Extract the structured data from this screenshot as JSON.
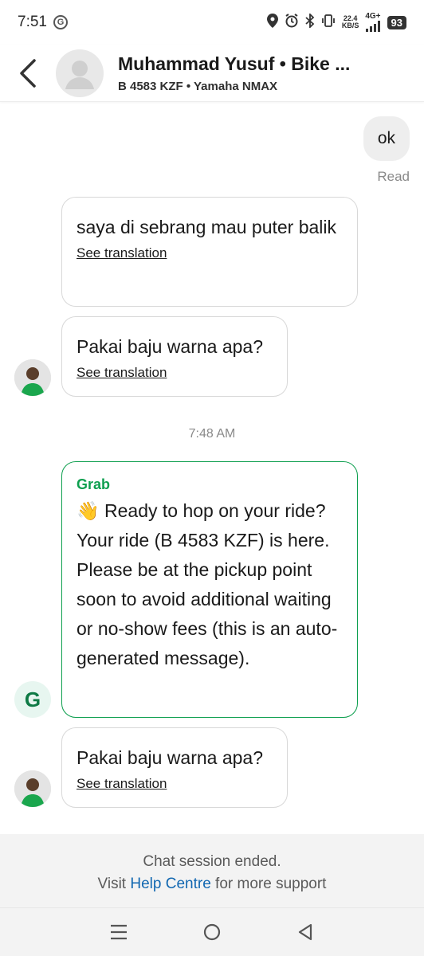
{
  "status_bar": {
    "time": "7:51",
    "carrier_icon_letter": "G",
    "net_speed_value": "22.4",
    "net_speed_unit": "KB/S",
    "network_type": "4G+",
    "battery": "93"
  },
  "header": {
    "driver_name": "Muhammad Yusuf • Bike ...",
    "vehicle_info": "B 4583 KZF • Yamaha NMAX"
  },
  "messages": {
    "outgoing_1": {
      "text": "ok",
      "status": "Read"
    },
    "incoming_1": {
      "text": "saya di sebrang mau puter balik",
      "translate_label": "See translation"
    },
    "incoming_2": {
      "text": "Pakai baju warna apa?",
      "translate_label": "See translation"
    },
    "timestamp": "7:48 AM",
    "system_1": {
      "sender": "Grab",
      "text": "👋 Ready to hop on your ride? Your ride (B 4583 KZF) is here. Please be at the pickup point soon to avoid additional waiting or no-show fees (this is an auto-generated message).",
      "avatar_letter": "G"
    },
    "incoming_3": {
      "text": "Pakai baju warna apa?",
      "translate_label": "See translation"
    }
  },
  "footer": {
    "session_ended": "Chat session ended.",
    "visit_prefix": "Visit",
    "help_link": "Help Centre",
    "visit_suffix": "for more support"
  },
  "colors": {
    "grab_green": "#0e9f4f",
    "link_blue": "#1167b1"
  },
  "icons": [
    "back-chevron-icon",
    "recents-icon",
    "home-icon",
    "back-triangle-icon"
  ]
}
